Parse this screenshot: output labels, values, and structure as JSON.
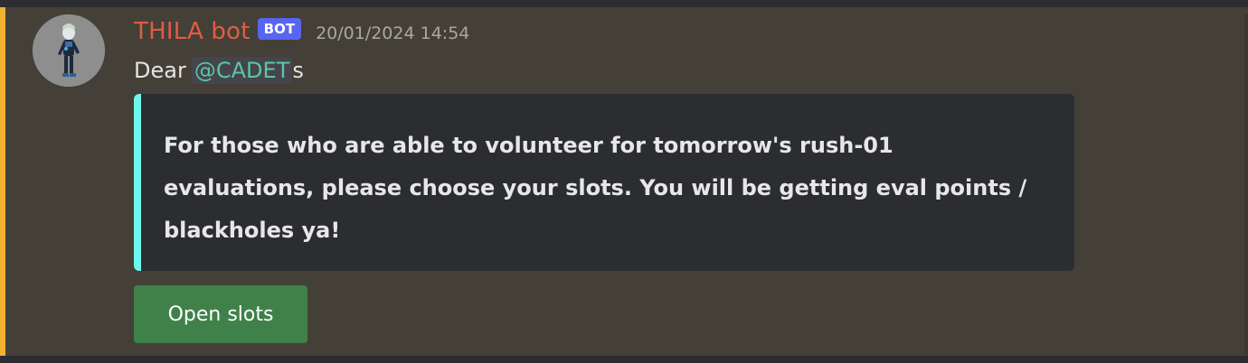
{
  "message": {
    "author": {
      "name": "THILA bot",
      "tag": "BOT",
      "color": "#e25c43"
    },
    "timestamp": "20/01/2024 14:54",
    "content": {
      "prefix": "Dear",
      "mention": "@CADET",
      "suffix": "s"
    },
    "embed": {
      "accent_color": "#6cf8ec",
      "lines": [
        "For those who are able to volunteer for tomorrow's rush-01",
        "evaluations, please choose your slots. You will be getting eval points /",
        "blackholes ya!"
      ]
    },
    "button": {
      "label": "Open slots",
      "color": "#3f8149"
    },
    "highlight_color": "#f0b232"
  },
  "icons": {
    "avatar": "bot-avatar-icon"
  }
}
